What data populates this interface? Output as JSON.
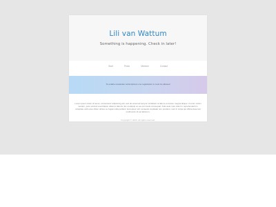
{
  "site": {
    "title": "Lili van Wattum",
    "tagline": "Something is happening. Check in later!"
  },
  "nav": {
    "items": [
      {
        "label": "Start"
      },
      {
        "label": "Photo"
      },
      {
        "label": "Member"
      },
      {
        "label": "Contact"
      }
    ]
  },
  "subscribe": {
    "text": "To enable newsletter subscriptions one registration is must be allowed"
  },
  "content": {
    "text": "Lorem ipsum dolor sit amet, consectetur adipiscing elit, sed do eiusmod tempor incididunt ut labore et dolore magna aliqua. Ut enim minim veniam, quis nostrud exercitation ullamco laboris nisi ut aliquip ex ea commodo consequat. Duis aute irure dolor in reprehenderit in voluptate velit esse cillum dolore eu fugiat nulla pariatur. Excepteur sint occaecat cupidatat non proident, sunt in culpa qui officia deserunt mollit anim id est laborum."
  },
  "footer": {
    "copyright": "Copyright © 2020. All rights reserved."
  },
  "colors": {
    "title": "#2f86c2",
    "page_bg": "#e6e6e6",
    "banner_start": "#b7daf6",
    "banner_end": "#d6c9ea"
  }
}
